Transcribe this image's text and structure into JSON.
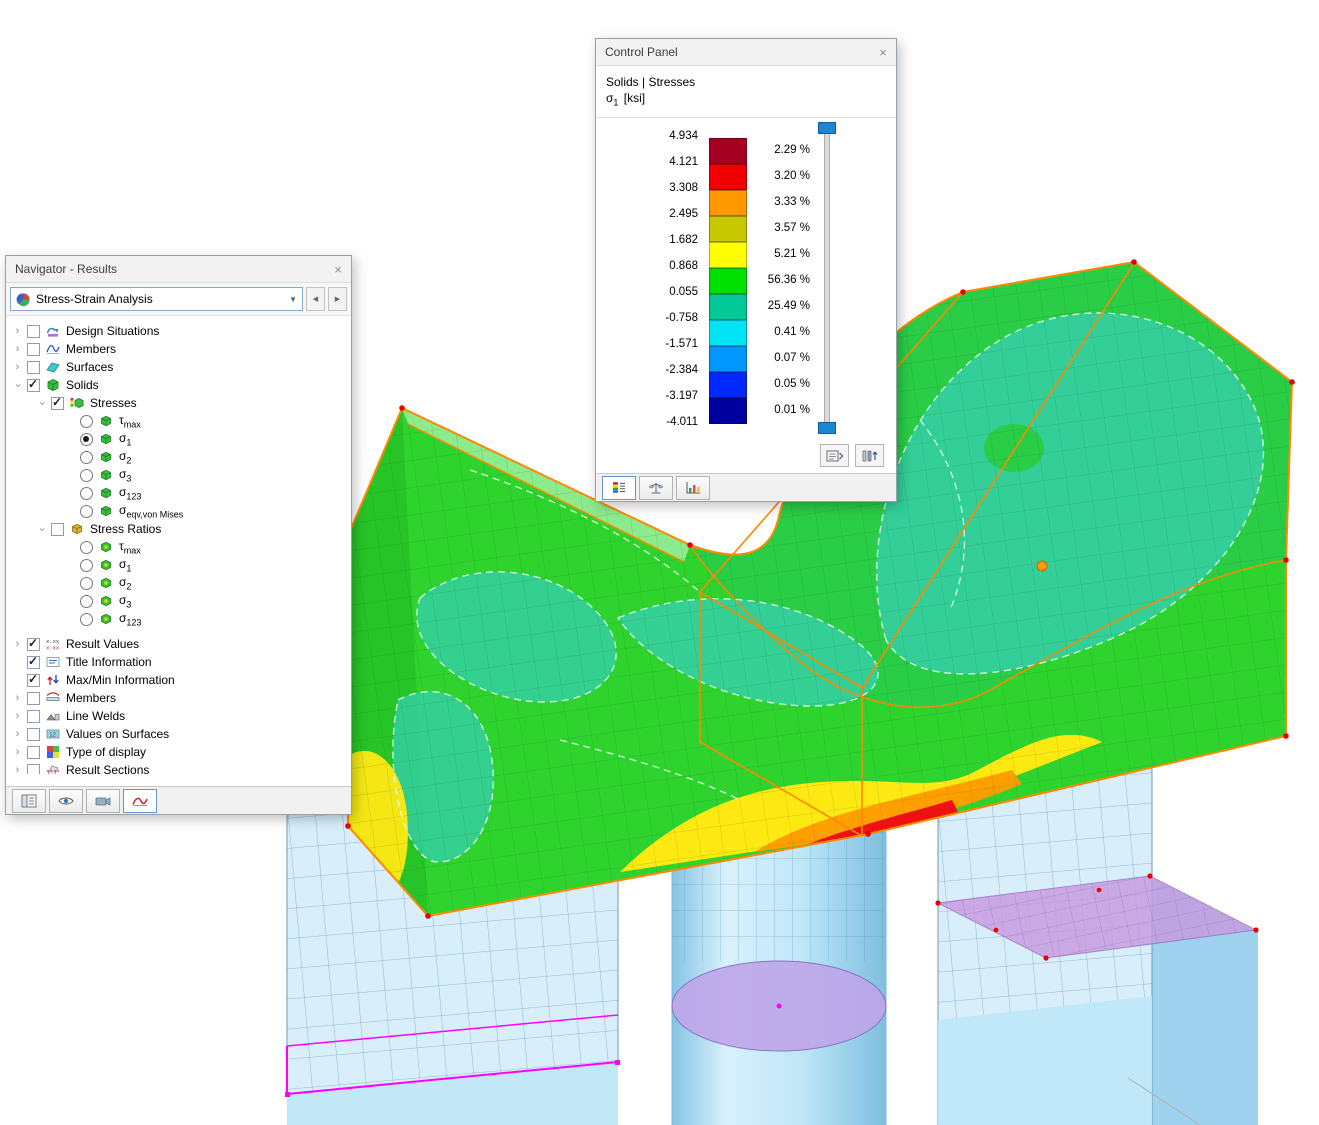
{
  "navigator": {
    "title": "Navigator - Results",
    "close_label": "×",
    "dropdown": {
      "value": "Stress-Strain Analysis",
      "icon": "analysis-icon"
    },
    "nav_buttons": {
      "prev": "◀",
      "next": "▶"
    },
    "tree": [
      {
        "level": 0,
        "expander": "collapsed",
        "control": "checkbox",
        "checked": false,
        "icon": "design-situations-icon",
        "label": "Design Situations"
      },
      {
        "level": 0,
        "expander": "collapsed",
        "control": "checkbox",
        "checked": false,
        "icon": "members-icon",
        "label": "Members"
      },
      {
        "level": 0,
        "expander": "collapsed",
        "control": "checkbox",
        "checked": false,
        "icon": "surfaces-icon",
        "label": "Surfaces"
      },
      {
        "level": 0,
        "expander": "expanded",
        "control": "checkbox",
        "checked": true,
        "icon": "solids-icon",
        "label": "Solids"
      },
      {
        "level": 1,
        "expander": "expanded",
        "control": "checkbox",
        "checked": true,
        "icon": "stresses-icon",
        "label": "Stresses"
      },
      {
        "level": 2,
        "expander": "none",
        "control": "radio",
        "checked": false,
        "icon": "stress-value-icon",
        "label": "τ",
        "sub": "max"
      },
      {
        "level": 2,
        "expander": "none",
        "control": "radio",
        "checked": true,
        "icon": "stress-value-icon",
        "label": "σ",
        "sub": "1"
      },
      {
        "level": 2,
        "expander": "none",
        "control": "radio",
        "checked": false,
        "icon": "stress-value-icon",
        "label": "σ",
        "sub": "2"
      },
      {
        "level": 2,
        "expander": "none",
        "control": "radio",
        "checked": false,
        "icon": "stress-value-icon",
        "label": "σ",
        "sub": "3"
      },
      {
        "level": 2,
        "expander": "none",
        "control": "radio",
        "checked": false,
        "icon": "stress-value-icon",
        "label": "σ",
        "sub": "123"
      },
      {
        "level": 2,
        "expander": "none",
        "control": "radio",
        "checked": false,
        "icon": "stress-value-icon",
        "label": "σ",
        "sub": "eqv,von Mises"
      },
      {
        "level": 1,
        "expander": "expanded",
        "control": "checkbox",
        "checked": false,
        "icon": "stress-ratios-icon",
        "label": "Stress Ratios"
      },
      {
        "level": 2,
        "expander": "none",
        "control": "radio",
        "checked": false,
        "icon": "stress-ratio-value-icon",
        "label": "τ",
        "sub": "max"
      },
      {
        "level": 2,
        "expander": "none",
        "control": "radio",
        "checked": false,
        "icon": "stress-ratio-value-icon",
        "label": "σ",
        "sub": "1"
      },
      {
        "level": 2,
        "expander": "none",
        "control": "radio",
        "checked": false,
        "icon": "stress-ratio-value-icon",
        "label": "σ",
        "sub": "2"
      },
      {
        "level": 2,
        "expander": "none",
        "control": "radio",
        "checked": false,
        "icon": "stress-ratio-value-icon",
        "label": "σ",
        "sub": "3"
      },
      {
        "level": 2,
        "expander": "none",
        "control": "radio",
        "checked": false,
        "icon": "stress-ratio-value-icon",
        "label": "σ",
        "sub": "123"
      },
      {
        "level": 0,
        "expander": "collapsed",
        "control": "checkbox",
        "checked": true,
        "icon": "result-values-icon",
        "label": "Result Values",
        "group_start": true
      },
      {
        "level": 0,
        "expander": "none",
        "control": "checkbox",
        "checked": true,
        "icon": "title-information-icon",
        "label": "Title Information"
      },
      {
        "level": 0,
        "expander": "none",
        "control": "checkbox",
        "checked": true,
        "icon": "max-min-information-icon",
        "label": "Max/Min Information"
      },
      {
        "level": 0,
        "expander": "collapsed",
        "control": "checkbox",
        "checked": false,
        "icon": "members-display-icon",
        "label": "Members"
      },
      {
        "level": 0,
        "expander": "collapsed",
        "control": "checkbox",
        "checked": false,
        "icon": "line-welds-icon",
        "label": "Line Welds"
      },
      {
        "level": 0,
        "expander": "collapsed",
        "control": "checkbox",
        "checked": false,
        "icon": "values-on-surfaces-icon",
        "label": "Values on Surfaces"
      },
      {
        "level": 0,
        "expander": "collapsed",
        "control": "checkbox",
        "checked": false,
        "icon": "type-of-display-icon",
        "label": "Type of display"
      },
      {
        "level": 0,
        "expander": "collapsed",
        "control": "checkbox",
        "checked": false,
        "icon": "result-sections-icon",
        "label": "Result Sections"
      }
    ],
    "tabs": [
      {
        "name": "data",
        "icon": "data-navigator-icon",
        "active": false
      },
      {
        "name": "display",
        "icon": "display-navigator-icon",
        "active": false
      },
      {
        "name": "views",
        "icon": "views-navigator-icon",
        "active": false
      },
      {
        "name": "results",
        "icon": "results-navigator-icon",
        "active": true
      }
    ]
  },
  "control_panel": {
    "title": "Control Panel",
    "close_label": "×",
    "header_line1": "Solids | Stresses",
    "result_symbol": "σ",
    "result_sub": "1",
    "result_unit": "[ksi]",
    "legend": {
      "boundary_values": [
        "4.934",
        "4.121",
        "3.308",
        "2.495",
        "1.682",
        "0.868",
        "0.055",
        "-0.758",
        "-1.571",
        "-2.384",
        "-3.197",
        "-4.011"
      ],
      "colors": [
        "#a50021",
        "#f00000",
        "#ff9800",
        "#c8c800",
        "#ffff00",
        "#00e000",
        "#00c896",
        "#00e4f5",
        "#0098ff",
        "#0028ff",
        "#0000a0"
      ],
      "percentages": [
        "2.29 %",
        "3.20 %",
        "3.33 %",
        "3.57 %",
        "5.21 %",
        "56.36 %",
        "25.49 %",
        "0.41 %",
        "0.07 %",
        "0.05 %",
        "0.01 %"
      ]
    },
    "buttons": [
      {
        "name": "panel-options",
        "icon": "panel-options-icon"
      },
      {
        "name": "scale-options",
        "icon": "scale-options-icon"
      }
    ],
    "tabs": [
      {
        "name": "color-scale",
        "icon": "color-scale-tab-icon",
        "active": true
      },
      {
        "name": "smooth-ranges",
        "icon": "smooth-ranges-tab-icon",
        "active": false
      },
      {
        "name": "result-diagram",
        "icon": "result-diagram-tab-icon",
        "active": false
      }
    ]
  },
  "scene": {
    "description": "3D FEA model: saddle-shaped solid block with sigma-1 stress contours resting on three piers",
    "colors": {
      "solid_green": "#2ed32e",
      "top_surface_green": "#2acd46",
      "left_face_green": "#27c427",
      "top_sliver_green": "#8ceb8c",
      "contour_teal": "#35cfa0",
      "contour_yellow": "#ffe913",
      "contour_orange": "#ff9c00",
      "contour_red": "#ee1111",
      "contour_dark_red": "#a50021",
      "selection_orange": "#ff8800",
      "node_red": "#e80000",
      "pier_blue": "#bfe7f8",
      "pier_blue_light": "#d8effb",
      "pier_blue_dark": "#9fd2ee",
      "cylinder_purple": "#bfa6ea",
      "pier_top_purple": "#c79ae0",
      "highlight_magenta": "#ff00ff",
      "mesh_blue_line": "#41769e",
      "mesh_green_line": "#0c4f0c"
    }
  }
}
